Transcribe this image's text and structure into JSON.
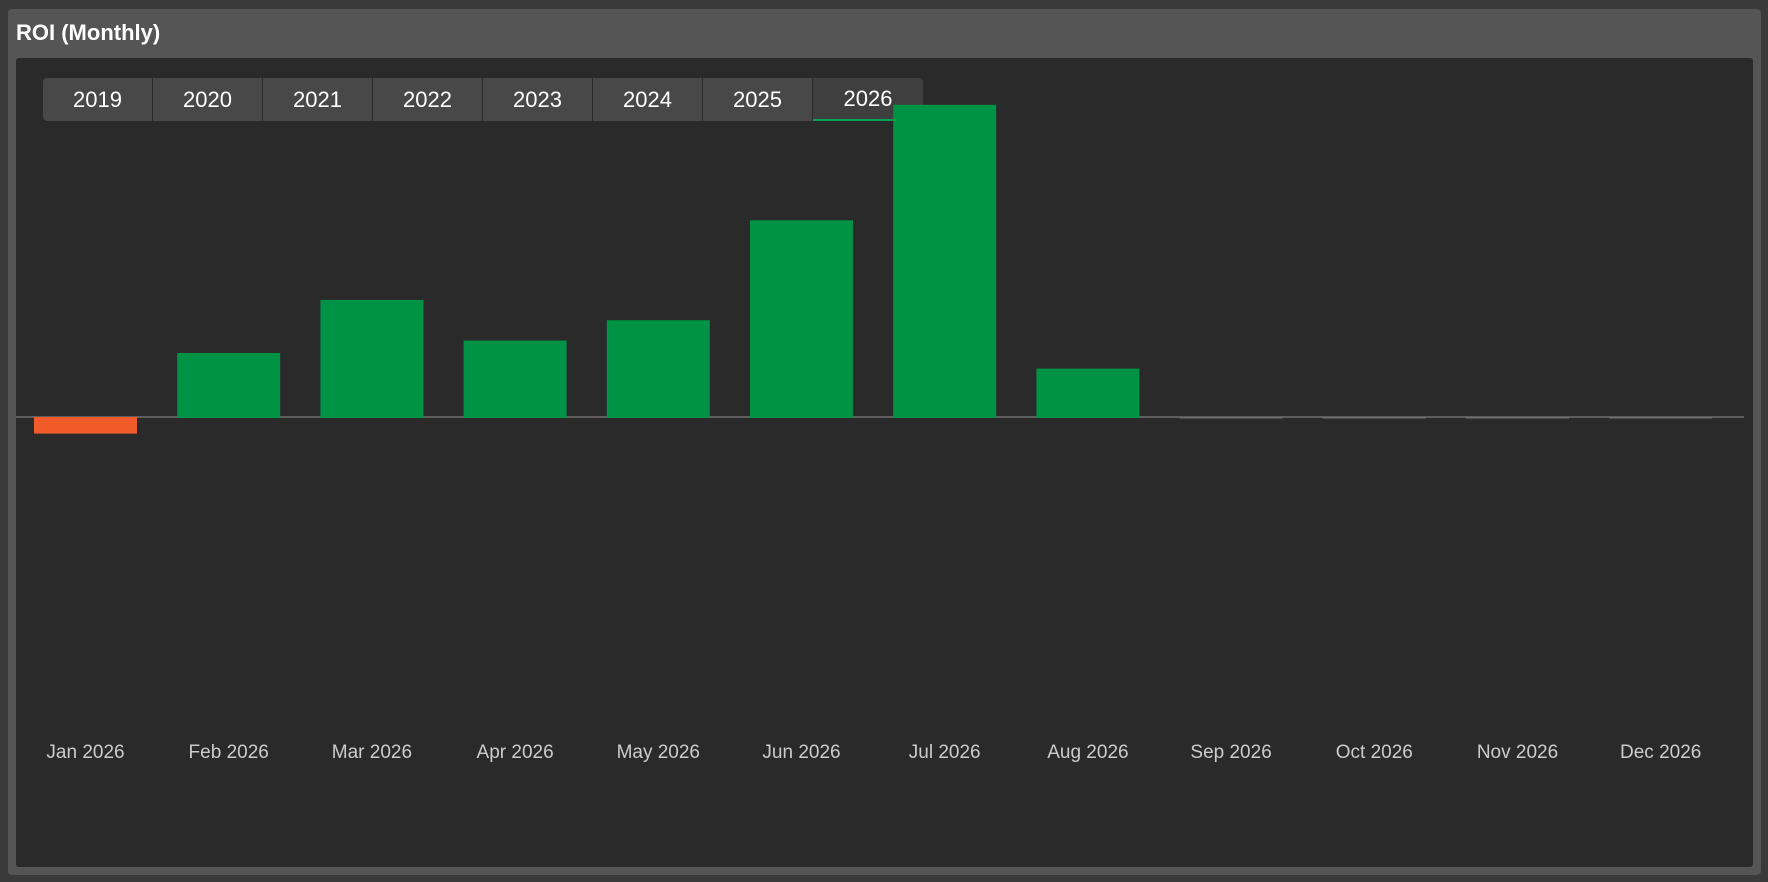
{
  "panel": {
    "title": "ROI (Monthly)"
  },
  "year_tabs": {
    "items": [
      "2019",
      "2020",
      "2021",
      "2022",
      "2023",
      "2024",
      "2025",
      "2026"
    ],
    "selected": "2026"
  },
  "colors": {
    "positive": "#009245",
    "negative": "#f15a29",
    "zero_line": "#6e6e6e",
    "tick_label": "#cccccc",
    "accent": "#00a651"
  },
  "chart_data": {
    "type": "bar",
    "categories": [
      "Jan 2026",
      "Feb 2026",
      "Mar 2026",
      "Apr 2026",
      "May 2026",
      "Jun 2026",
      "Jul 2026",
      "Aug 2026",
      "Sep 2026",
      "Oct 2026",
      "Nov 2026",
      "Dec 2026"
    ],
    "values": [
      -1.0,
      4.1,
      7.5,
      4.9,
      6.2,
      12.6,
      20.0,
      3.1,
      0,
      0,
      0,
      0
    ],
    "ylim": [
      -20.5,
      20.5
    ],
    "title": "",
    "xlabel": "",
    "ylabel": "",
    "grid": false,
    "legend": "none"
  }
}
